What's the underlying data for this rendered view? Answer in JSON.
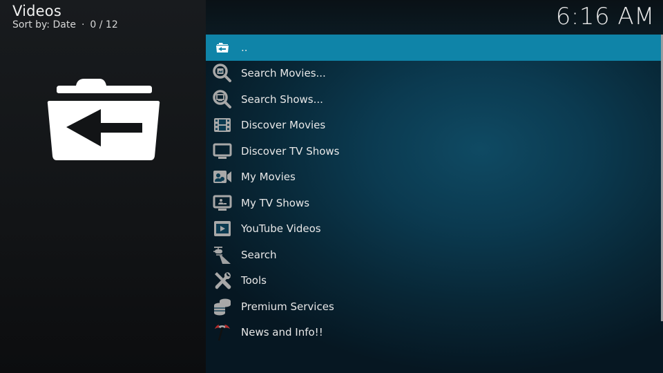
{
  "header": {
    "title": "Videos",
    "sort_label": "Sort by: Date",
    "separator": "·",
    "count": "0 / 12",
    "clock": "6:16 AM"
  },
  "preview": {
    "icon": "folder-back-icon"
  },
  "colors": {
    "selected_bg": "#0f84a8",
    "text": "#e8e8e8",
    "icon_gray": "#a8a8a8"
  },
  "items": [
    {
      "label": "..",
      "icon": "folder-back-icon",
      "selected": true
    },
    {
      "label": "Search Movies...",
      "icon": "search-movies-icon"
    },
    {
      "label": "Search Shows...",
      "icon": "search-shows-icon"
    },
    {
      "label": "Discover Movies",
      "icon": "film-strip-icon"
    },
    {
      "label": "Discover TV Shows",
      "icon": "tv-icon"
    },
    {
      "label": "My Movies",
      "icon": "video-camera-icon"
    },
    {
      "label": "My TV Shows",
      "icon": "tv-user-icon"
    },
    {
      "label": "YouTube Videos",
      "icon": "play-screen-icon"
    },
    {
      "label": "Search",
      "icon": "helicopter-search-icon"
    },
    {
      "label": "Tools",
      "icon": "tools-icon"
    },
    {
      "label": "Premium Services",
      "icon": "coins-icon"
    },
    {
      "label": "News and Info!!",
      "icon": "umbrella-icon"
    }
  ]
}
